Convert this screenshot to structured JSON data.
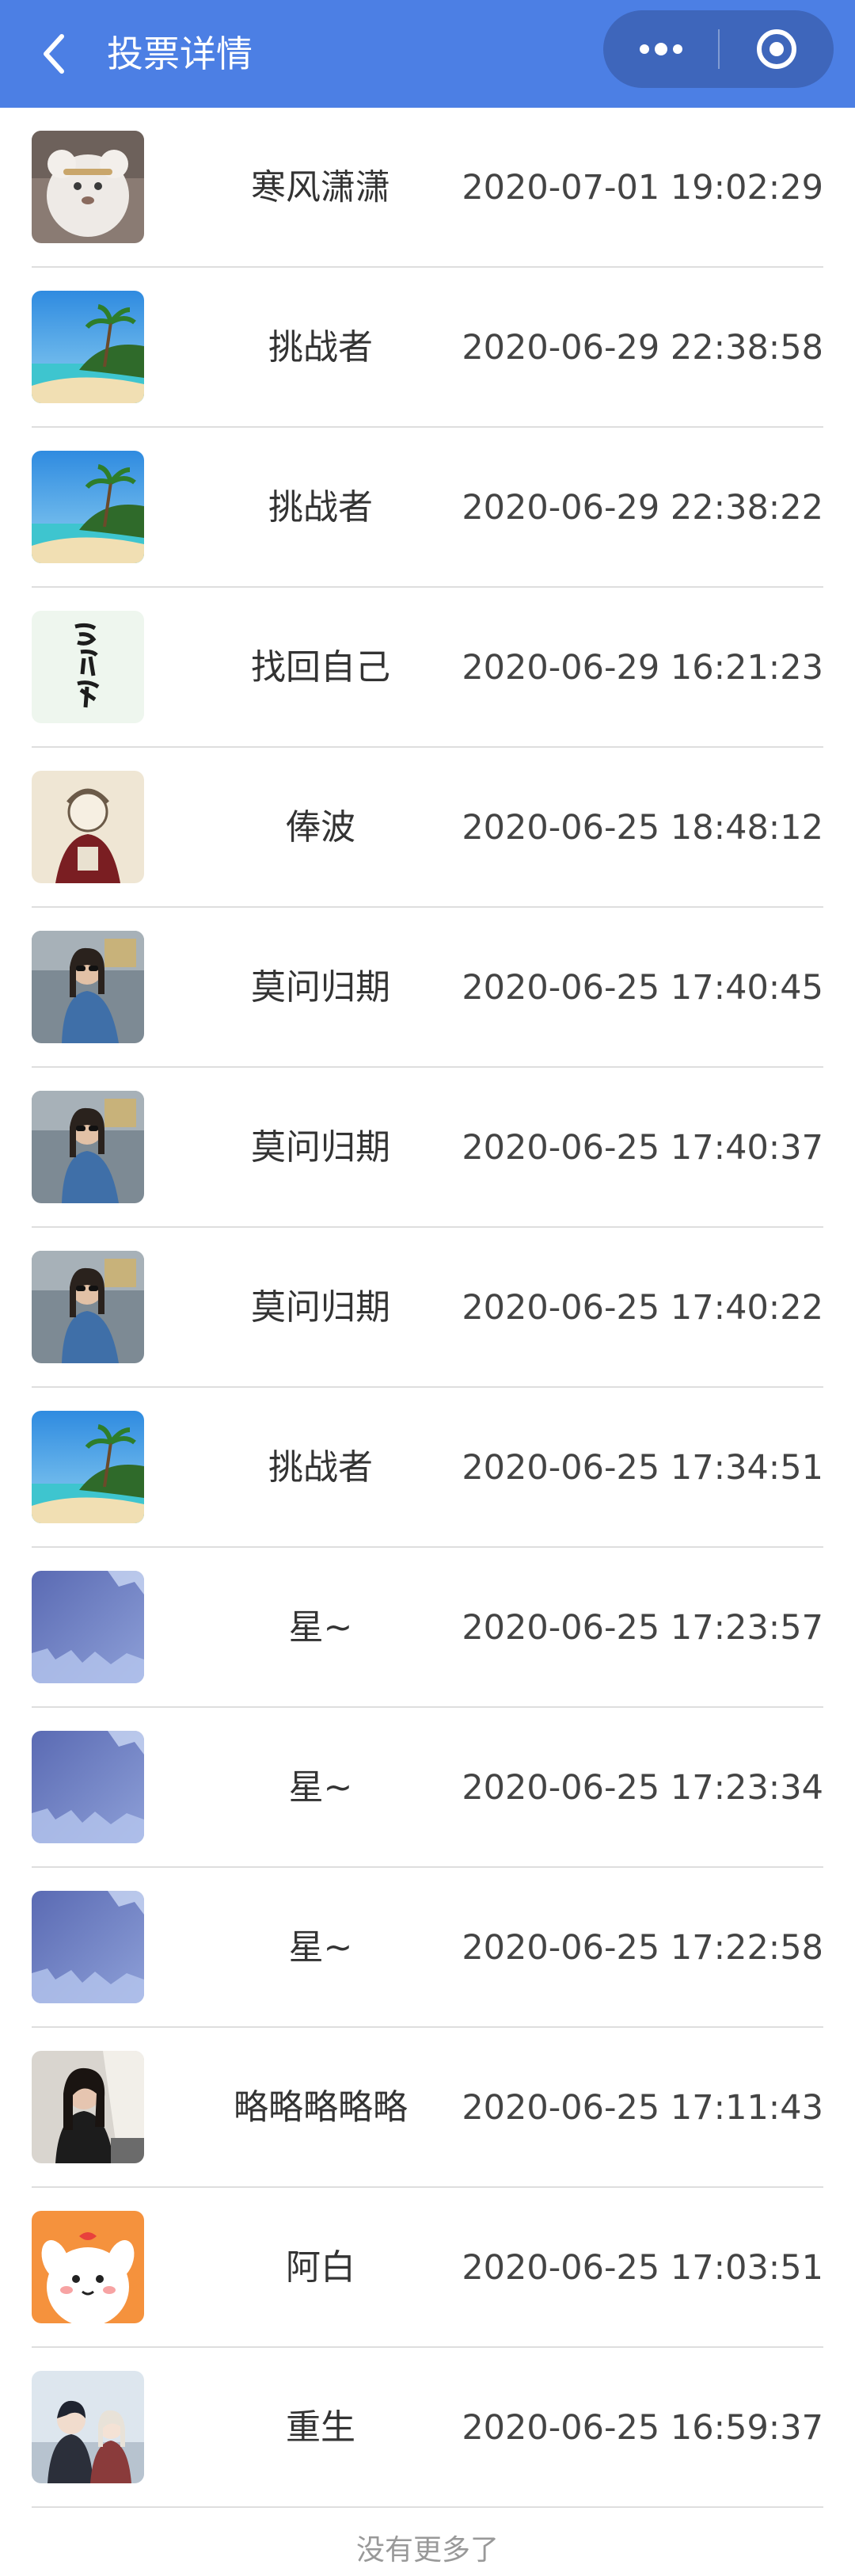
{
  "navbar": {
    "title": "投票详情",
    "background": "#4c7fe4",
    "icons": {
      "back": "chevron-left-icon",
      "more": "more-dots-icon",
      "close": "target-circle-icon"
    }
  },
  "votes": [
    {
      "name": "寒风潇潇",
      "time": "2020-07-01 19:02:29",
      "avatar": "fluffy-bear-avatar"
    },
    {
      "name": "挑战者",
      "time": "2020-06-29 22:38:58",
      "avatar": "beach-palm-avatar"
    },
    {
      "name": "挑战者",
      "time": "2020-06-29 22:38:22",
      "avatar": "beach-palm-avatar"
    },
    {
      "name": "找回自己",
      "time": "2020-06-29 16:21:23",
      "avatar": "calligraphy-avatar"
    },
    {
      "name": "俸波",
      "time": "2020-06-25 18:48:12",
      "avatar": "sketch-portrait-avatar"
    },
    {
      "name": "莫问归期",
      "time": "2020-06-25 17:40:45",
      "avatar": "woman-sunglasses-avatar"
    },
    {
      "name": "莫问归期",
      "time": "2020-06-25 17:40:37",
      "avatar": "woman-sunglasses-avatar"
    },
    {
      "name": "莫问归期",
      "time": "2020-06-25 17:40:22",
      "avatar": "woman-sunglasses-avatar"
    },
    {
      "name": "挑战者",
      "time": "2020-06-25 17:34:51",
      "avatar": "beach-palm-avatar"
    },
    {
      "name": "星~",
      "time": "2020-06-25 17:23:57",
      "avatar": "blue-abstract-avatar"
    },
    {
      "name": "星~",
      "time": "2020-06-25 17:23:34",
      "avatar": "blue-abstract-avatar"
    },
    {
      "name": "星~",
      "time": "2020-06-25 17:22:58",
      "avatar": "blue-abstract-avatar"
    },
    {
      "name": "略略略略略",
      "time": "2020-06-25 17:11:43",
      "avatar": "woman-dark-avatar"
    },
    {
      "name": "阿白",
      "time": "2020-06-25 17:03:51",
      "avatar": "cartoon-dog-avatar"
    },
    {
      "name": "重生",
      "time": "2020-06-25 16:59:37",
      "avatar": "anime-couple-avatar"
    }
  ],
  "footer": {
    "no_more": "没有更多了"
  }
}
